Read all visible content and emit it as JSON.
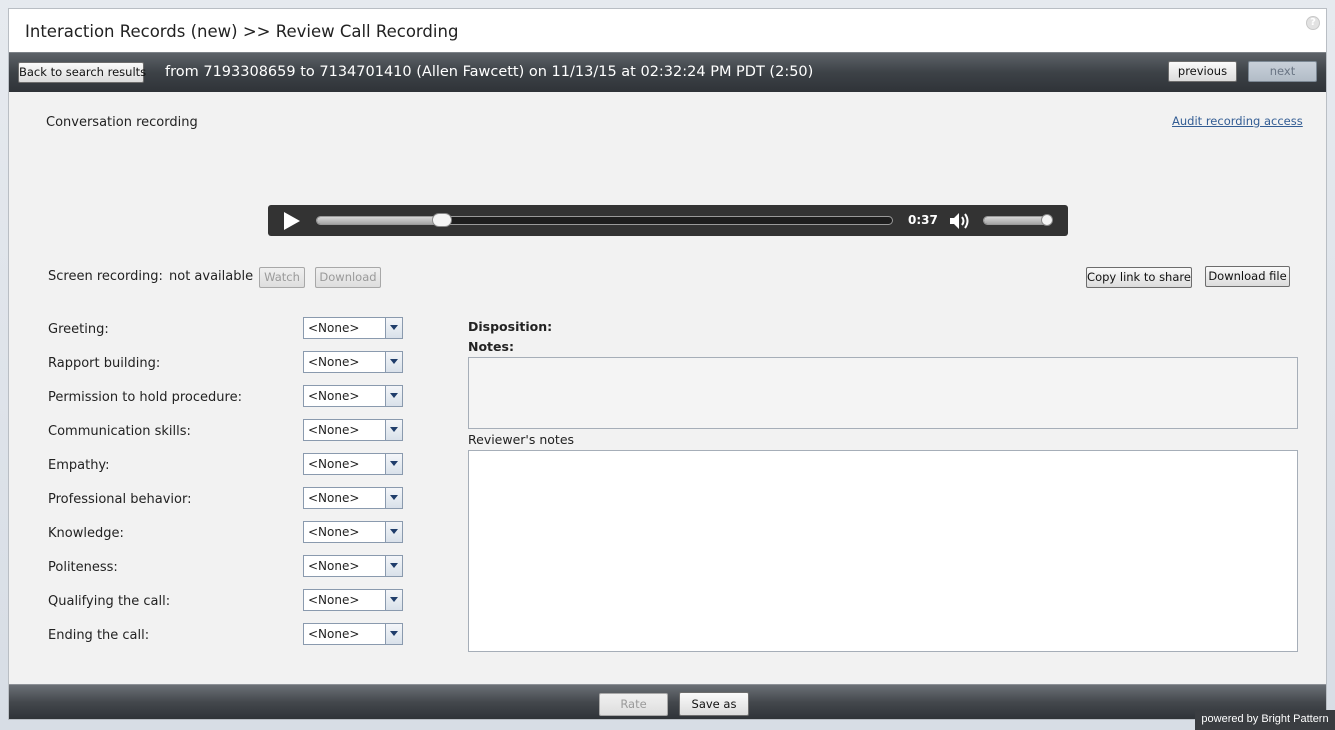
{
  "window": {
    "title": "Interaction Records (new) >> Review Call Recording"
  },
  "header": {
    "back_label": "Back to search results",
    "info": "from 7193308659 to 7134701410 (Allen Fawcett) on 11/13/15 at 02:32:24 PM PDT (2:50)",
    "previous_label": "previous",
    "next_label": "next"
  },
  "recording": {
    "section_label": "Conversation recording",
    "audit_link": "Audit recording access",
    "player": {
      "current_time": "0:37",
      "duration_seconds": 170,
      "current_seconds": 37,
      "volume": 1.0
    }
  },
  "screen_recording": {
    "label": "Screen recording:",
    "status": "not available",
    "watch_label": "Watch",
    "download_label": "Download",
    "copy_link_label": "Copy link to share",
    "download_file_label": "Download file"
  },
  "ratings": [
    {
      "label": "Greeting:",
      "value": "<None>"
    },
    {
      "label": "Rapport building:",
      "value": "<None>"
    },
    {
      "label": "Permission to hold procedure:",
      "value": "<None>"
    },
    {
      "label": "Communication skills:",
      "value": "<None>"
    },
    {
      "label": "Empathy:",
      "value": "<None>"
    },
    {
      "label": "Professional behavior:",
      "value": "<None>"
    },
    {
      "label": "Knowledge:",
      "value": "<None>"
    },
    {
      "label": "Politeness:",
      "value": "<None>"
    },
    {
      "label": "Qualifying the call:",
      "value": "<None>"
    },
    {
      "label": "Ending the call:",
      "value": "<None>"
    }
  ],
  "notes": {
    "disposition_label": "Disposition:",
    "notes_label": "Notes:",
    "notes_value": "",
    "reviewer_label": "Reviewer's notes",
    "reviewer_value": ""
  },
  "footer": {
    "rate_label": "Rate",
    "save_label": "Save as",
    "powered_by": "powered by Bright Pattern"
  }
}
